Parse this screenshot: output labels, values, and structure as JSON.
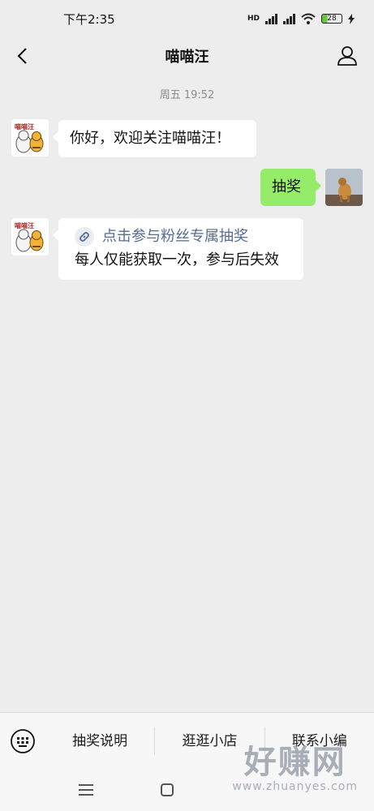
{
  "status_bar": {
    "time": "下午2:35",
    "network_badge": "HD",
    "battery": "28"
  },
  "header": {
    "title": "喵喵汪"
  },
  "chat": {
    "timestamp": "周五 19:52",
    "official_avatar_text": "喵喵汪",
    "messages": [
      {
        "from": "official",
        "text": "你好，欢迎关注喵喵汪！"
      },
      {
        "from": "user",
        "text": "抽奖"
      },
      {
        "from": "official",
        "link_text": "点击参与粉丝专属抽奖",
        "text": "每人仅能获取一次，参与后失效"
      }
    ]
  },
  "menu": {
    "items": [
      "抽奖说明",
      "逛逛小店",
      "联系小编"
    ]
  },
  "watermark": {
    "big": "好赚网",
    "small": "www.zhuanyes.com"
  },
  "colors": {
    "background": "#ededed",
    "user_bubble": "#95ec69",
    "link": "#576b95",
    "battery_fill": "#63c83f"
  }
}
